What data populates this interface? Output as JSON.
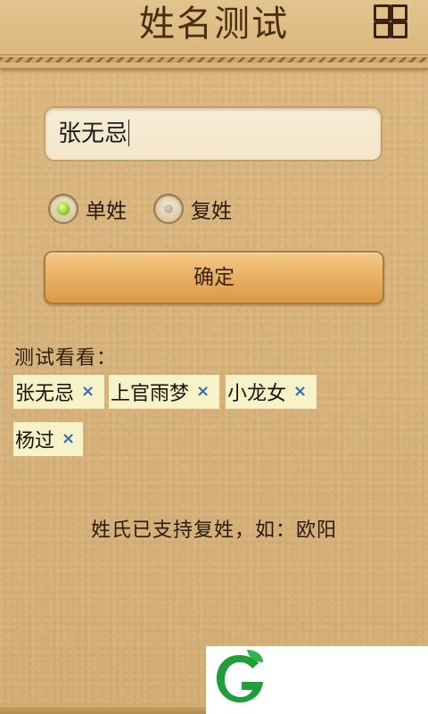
{
  "header": {
    "title": "姓名测试",
    "menu_icon": "grid-icon"
  },
  "form": {
    "name_value": "张无忌",
    "radio_single_label": "单姓",
    "radio_compound_label": "复姓",
    "selected_option": "单姓",
    "confirm_label": "确定"
  },
  "examples": {
    "label": "测试看看：",
    "tags": [
      {
        "name": "张无忌",
        "remove": "×"
      },
      {
        "name": "上官雨梦",
        "remove": "×"
      },
      {
        "name": "小龙女",
        "remove": "×"
      },
      {
        "name": "杨过",
        "remove": "×"
      }
    ]
  },
  "hint": "姓氏已支持复姓，如：欧阳",
  "colors": {
    "leather": "#d9b67e",
    "button_orange": "#e7ad5f",
    "tag_bg": "#f8f2c8",
    "remove_x": "#2e6fb5",
    "radio_on": "#8fd12c",
    "logo_green": "#1f9e3a"
  }
}
